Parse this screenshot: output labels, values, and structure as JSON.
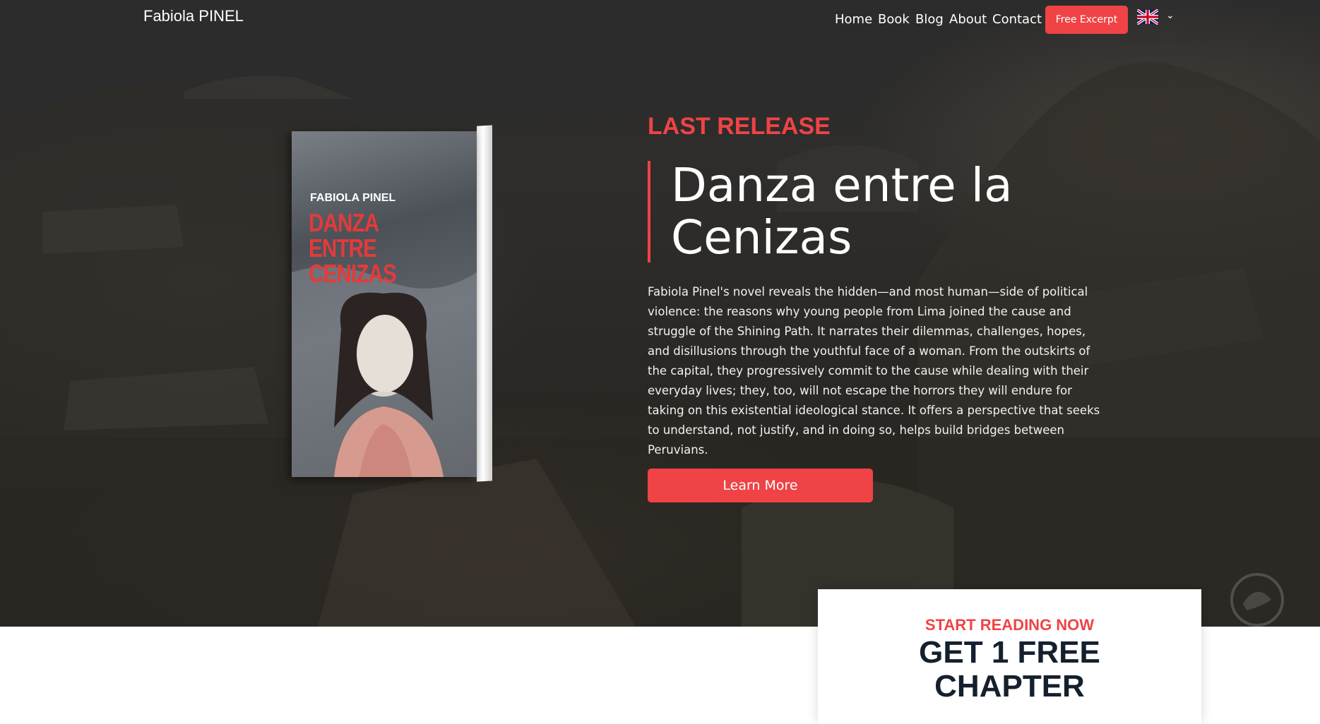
{
  "nav": {
    "brand": "Fabiola PINEL",
    "items": [
      {
        "label": "Home"
      },
      {
        "label": "Book"
      },
      {
        "label": "Blog"
      },
      {
        "label": "About"
      },
      {
        "label": "Contact"
      }
    ],
    "cta": "Free Excerpt",
    "language_icon": "uk-flag-icon"
  },
  "hero": {
    "eyebrow": "LAST RELEASE",
    "title_line1": "Danza entre la",
    "title_line2": "Cenizas",
    "description": "Fabiola Pinel's novel reveals the hidden—and most human—side of political violence: the reasons why young people from Lima joined the cause and struggle of the Shining Path. It narrates their dilemmas, challenges, hopes, and disillusions through the youthful face of a woman. From the outskirts of the capital, they progressively commit to the cause while dealing with their everyday lives; they, too, will not escape the horrors they will endure for taking on this existential ideological stance. It offers a perspective that seeks to understand, not justify, and in doing so, helps build bridges between Peruvians.",
    "button": "Learn More"
  },
  "book": {
    "author": "FABIOLA PINEL",
    "title": "DANZA ENTRE CENIZAS"
  },
  "card": {
    "eyebrow": "START READING NOW",
    "title_line1": "GET 1 FREE",
    "title_line2": "CHAPTER"
  },
  "colors": {
    "accent": "#ef4346",
    "dark_text": "#15202e"
  }
}
